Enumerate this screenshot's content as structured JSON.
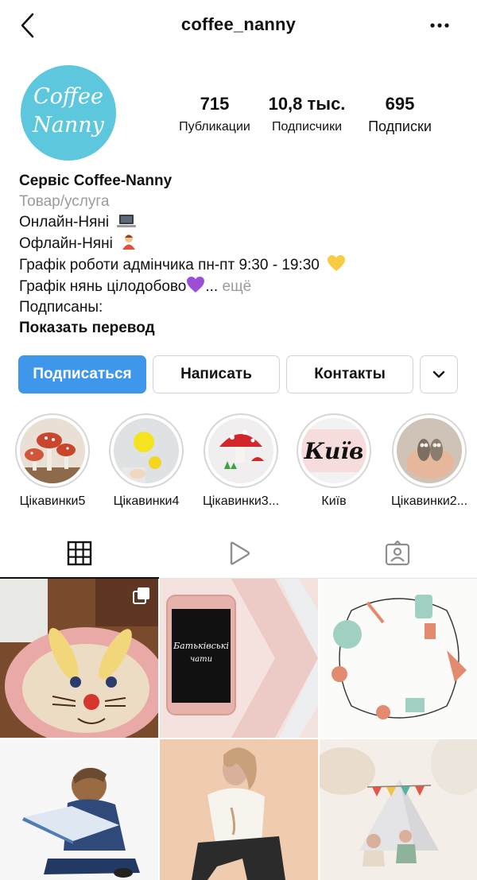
{
  "header": {
    "username": "coffee_nanny",
    "icons": [
      "chevron-left-icon",
      "more-horizontal-icon"
    ]
  },
  "profile": {
    "avatar_text_line1": "Coffee",
    "avatar_text_line2": "Nanny",
    "avatar_color": "#5dc7de",
    "stats": [
      {
        "value": "715",
        "label": "Публикации"
      },
      {
        "value": "10,8 тыс.",
        "label": "Подписчики"
      },
      {
        "value": "695",
        "label": "Подписки"
      }
    ]
  },
  "bio": {
    "name": "Сервіс Coffee-Nanny",
    "category": "Товар/услуга",
    "line1": "Онлайн-Няні",
    "line2": "Офлайн-Няні",
    "line3": "Графік роботи адмінчика пн-пт 9:30 - 19:30",
    "line4": "Графік нянь цілодобово",
    "ellipsis": "...",
    "more": "ещё",
    "followed_by": "Подписаны:",
    "translate": "Показать перевод"
  },
  "actions": {
    "follow": "Подписаться",
    "message": "Написать",
    "contacts": "Контакты"
  },
  "highlights": [
    {
      "label": "Цікавинки5"
    },
    {
      "label": "Цікавинки4"
    },
    {
      "label": "Цікавинки3..."
    },
    {
      "label": "Київ",
      "cover_text": "Київ"
    },
    {
      "label": "Цікавинки2..."
    }
  ],
  "tabs": [
    "grid-icon",
    "reels-play-icon",
    "tagged-person-icon"
  ],
  "posts": [
    {
      "id": 1
    },
    {
      "id": 2,
      "text_line1": "Батьківські",
      "text_line2": "чати"
    },
    {
      "id": 3
    },
    {
      "id": 4
    },
    {
      "id": 5
    },
    {
      "id": 6
    }
  ],
  "colors": {
    "accent": "#3f97ec",
    "muted": "#9b9b9b"
  }
}
